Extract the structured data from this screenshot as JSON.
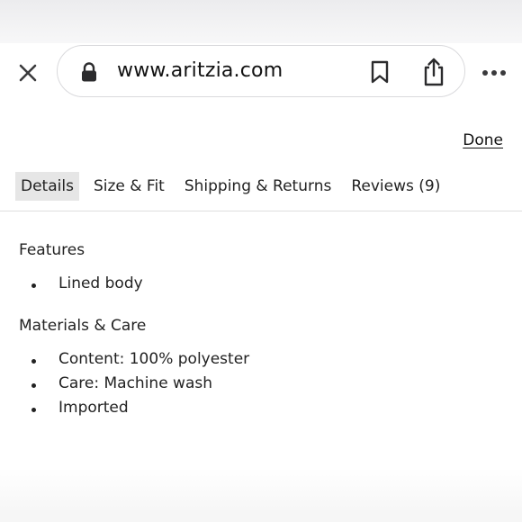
{
  "browser": {
    "url": "www.aritzia.com",
    "icons": [
      "close-icon",
      "lock-icon",
      "bookmark-icon",
      "share-icon",
      "more-icon"
    ]
  },
  "sheet": {
    "done_label": "Done",
    "tabs": [
      {
        "label": "Details",
        "active": true
      },
      {
        "label": "Size & Fit",
        "active": false
      },
      {
        "label": "Shipping & Returns",
        "active": false
      },
      {
        "label": "Reviews (9)",
        "active": false
      }
    ]
  },
  "details": {
    "features": {
      "title": "Features",
      "items": [
        "Lined body"
      ]
    },
    "materials": {
      "title": "Materials & Care",
      "items": [
        "Content: 100% polyester",
        "Care: Machine wash",
        "Imported"
      ]
    }
  }
}
